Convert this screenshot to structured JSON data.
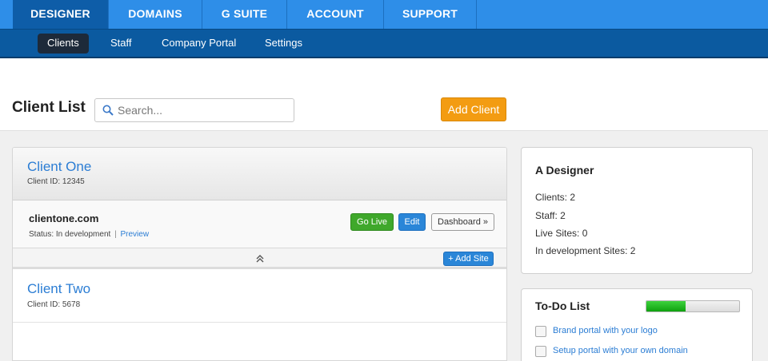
{
  "top_nav": {
    "tabs": [
      {
        "label": "DESIGNER",
        "active": true
      },
      {
        "label": "DOMAINS",
        "active": false
      },
      {
        "label": "G SUITE",
        "active": false
      },
      {
        "label": "ACCOUNT",
        "active": false
      },
      {
        "label": "SUPPORT",
        "active": false
      }
    ]
  },
  "sub_nav": {
    "items": [
      {
        "label": "Clients",
        "active": true
      },
      {
        "label": "Staff",
        "active": false
      },
      {
        "label": "Company Portal",
        "active": false
      },
      {
        "label": "Settings",
        "active": false
      }
    ]
  },
  "toolbar": {
    "title": "Client List",
    "search_placeholder": "Search...",
    "add_client_label": "Add Client"
  },
  "clients": [
    {
      "name": "Client One",
      "id_text": "Client ID: 12345",
      "site": {
        "domain": "clientone.com",
        "status_text": "Status: In development",
        "separator": "|",
        "preview_label": "Preview",
        "go_live_label": "Go Live",
        "edit_label": "Edit",
        "dashboard_label": "Dashboard »"
      },
      "add_site_label": "+ Add Site"
    },
    {
      "name": "Client Two",
      "id_text": "Client ID: 5678"
    }
  ],
  "designer": {
    "title": "A Designer",
    "stats": [
      "Clients: 2",
      "Staff: 2",
      "Live Sites: 0",
      "In development Sites: 2"
    ]
  },
  "todo": {
    "title": "To-Do List",
    "progress_fraction": 0.42,
    "items": [
      {
        "label": "Brand portal with your logo",
        "checked": false
      },
      {
        "label": "Setup portal with your own domain",
        "checked": false
      }
    ]
  },
  "colors": {
    "top_nav": "#2e8ee8",
    "sub_nav": "#0b5aa0",
    "link": "#2b7dd4",
    "add_client": "#f39c12",
    "go_live": "#3fa82b",
    "progress": "#1fb51f"
  },
  "icons": {
    "search": "search-icon",
    "collapse": "collapse-up-icon"
  }
}
